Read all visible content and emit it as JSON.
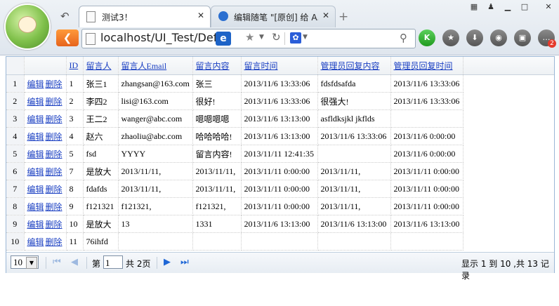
{
  "browser": {
    "tabs": [
      {
        "label": "测试3！",
        "close": "✕"
      },
      {
        "label": "编辑随笔 \"[原创] 给 A...",
        "close": "✕"
      }
    ],
    "new_tab": "+",
    "address_url": "localhost/UI_Test/Defa",
    "ie_mode_label": "e",
    "badge_count": "2"
  },
  "grid": {
    "columns": [
      "ID",
      "留言人",
      "留言人Email",
      "留言内容",
      "留言时间",
      "管理员回复内容",
      "管理员回复时间"
    ],
    "edit_label": "编辑",
    "delete_label": "删除",
    "rows": [
      {
        "rn": "1",
        "id": "1",
        "name": "张三1",
        "email": "zhangsan@163.com",
        "content": "张三",
        "time": "2013/11/6 13:33:06",
        "reply": "fdsfdsafda",
        "reply_time": "2013/11/6 13:33:06"
      },
      {
        "rn": "2",
        "id": "2",
        "name": "李四2",
        "email": "lisi@163.com",
        "content": "很好!",
        "time": "2013/11/6 13:33:06",
        "reply": "很强大!",
        "reply_time": "2013/11/6 13:33:06"
      },
      {
        "rn": "3",
        "id": "3",
        "name": "王二2",
        "email": "wanger@abc.com",
        "content": "嗯嗯嗯嗯",
        "time": "2013/11/6 13:13:00",
        "reply": "asfldksjkl jkflds",
        "reply_time": ""
      },
      {
        "rn": "4",
        "id": "4",
        "name": "赵六",
        "email": "zhaoliu@abc.com",
        "content": "哈哈哈哈!",
        "time": "2013/11/6 13:13:00",
        "reply": "2013/11/6 13:33:06",
        "reply_time": "2013/11/6 0:00:00"
      },
      {
        "rn": "5",
        "id": "5",
        "name": "fsd",
        "email": "YYYY",
        "content": "留言内容!",
        "time": "2013/11/11 12:41:35",
        "reply": "",
        "reply_time": "2013/11/6 0:00:00"
      },
      {
        "rn": "6",
        "id": "7",
        "name": "是放大",
        "email": "2013/11/11,",
        "content": "2013/11/11,",
        "time": "2013/11/11 0:00:00",
        "reply": "2013/11/11,",
        "reply_time": "2013/11/11 0:00:00"
      },
      {
        "rn": "7",
        "id": "8",
        "name": "fdafds",
        "email": "2013/11/11,",
        "content": "2013/11/11,",
        "time": "2013/11/11 0:00:00",
        "reply": "2013/11/11,",
        "reply_time": "2013/11/11 0:00:00"
      },
      {
        "rn": "8",
        "id": "9",
        "name": "f121321",
        "email": "f121321,",
        "content": "f121321,",
        "time": "2013/11/11 0:00:00",
        "reply": "2013/11/11,",
        "reply_time": "2013/11/11 0:00:00"
      },
      {
        "rn": "9",
        "id": "10",
        "name": "是放大",
        "email": "13",
        "content": "1331",
        "time": "2013/11/6 13:13:00",
        "reply": "2013/11/6 13:13:00",
        "reply_time": "2013/11/6 13:13:00"
      },
      {
        "rn": "10",
        "id": "11",
        "name": "76ihfd",
        "email": "",
        "content": "",
        "time": "",
        "reply": "",
        "reply_time": ""
      }
    ]
  },
  "pager": {
    "page_size": "10",
    "page_label": "第",
    "page_number": "1",
    "total_label": "共 2页",
    "summary": "显示 1 到 10 ,共 13 记录"
  }
}
